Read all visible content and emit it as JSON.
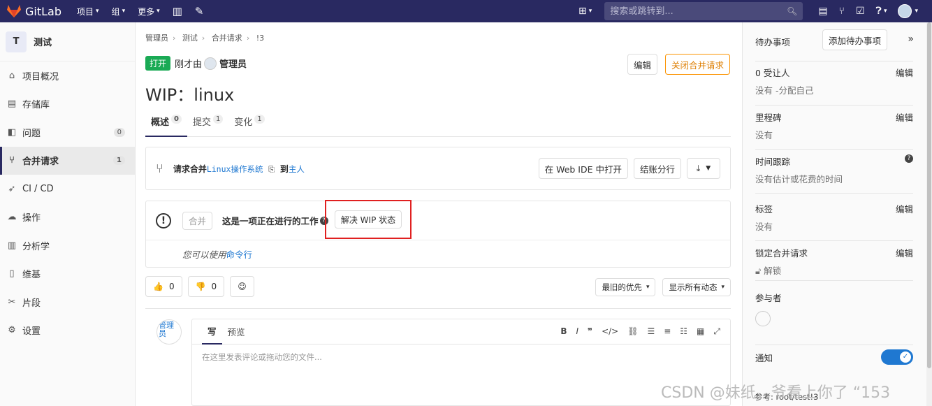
{
  "topbar": {
    "brand": "GitLab",
    "nav": [
      {
        "label": "项目"
      },
      {
        "label": "组"
      },
      {
        "label": "更多"
      }
    ],
    "search_placeholder": "搜索或跳转到..."
  },
  "sidebar": {
    "project_initial": "T",
    "project_name": "测试",
    "items": [
      {
        "label": "项目概况",
        "icon": "home-icon"
      },
      {
        "label": "存储库",
        "icon": "doc-icon"
      },
      {
        "label": "问题",
        "icon": "issues-icon",
        "count": "0"
      },
      {
        "label": "合并请求",
        "icon": "merge-request-icon",
        "count": "1"
      },
      {
        "label": "CI / CD",
        "icon": "rocket-icon"
      },
      {
        "label": "操作",
        "icon": "cloud-icon"
      },
      {
        "label": "分析学",
        "icon": "chart-icon"
      },
      {
        "label": "维基",
        "icon": "book-icon"
      },
      {
        "label": "片段",
        "icon": "scissors-icon"
      },
      {
        "label": "设置",
        "icon": "gear-icon"
      }
    ]
  },
  "breadcrumb": [
    "管理员",
    "测试",
    "合并请求",
    "!3"
  ],
  "mr": {
    "status": "打开",
    "byline": "刚才由",
    "author": "管理员",
    "edit_label": "编辑",
    "close_label": "关闭合并请求",
    "title": "WIP：linux",
    "tabs": [
      {
        "label": "概述",
        "count": "0"
      },
      {
        "label": "提交",
        "count": "1"
      },
      {
        "label": "变化",
        "count": "1"
      }
    ],
    "request_prefix": "请求合并",
    "source_branch": "Linux操作系统",
    "to_word": "到",
    "target_branch": "主人",
    "web_ide_label": "在 Web IDE 中打开",
    "checkout_label": "结账分行",
    "merge_label": "合并",
    "wip_text": "这是一项正在进行的工作",
    "resolve_wip_label": "解决 WIP 状态",
    "cli_hint": "您可以使用",
    "cli_link": "命令行",
    "thumbs_up": "0",
    "thumbs_down": "0",
    "sort_label": "最旧的优先",
    "filter_label": "显示所有动态",
    "commenter_avatar_alt": "管理员",
    "write_tab": "写",
    "preview_tab": "预览",
    "comment_placeholder": "在这里发表评论或拖动您的文件..."
  },
  "right": {
    "todo_title": "待办事项",
    "add_todo": "添加待办事项",
    "assignee_title": "0 受让人",
    "assignee_value": "没有 -分配自己",
    "milestone_title": "里程碑",
    "milestone_value": "没有",
    "time_title": "时间跟踪",
    "time_value": "没有估计或花费的时间",
    "labels_title": "标签",
    "labels_value": "没有",
    "lock_title": "锁定合并请求",
    "lock_value": "解锁",
    "participants_title": "参与者",
    "notify_title": "通知",
    "edit_label": "编辑",
    "reference": "参考: root/test!3"
  },
  "watermark": "CSDN @妹纸，爷看上你了 “153"
}
